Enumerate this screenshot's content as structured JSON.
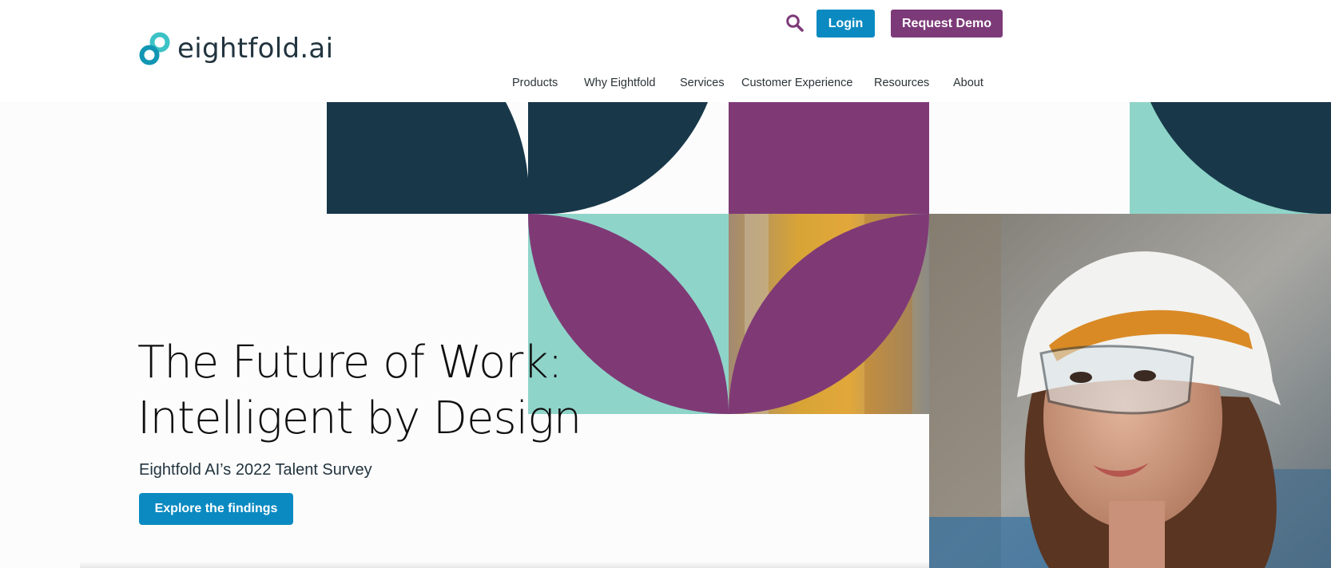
{
  "brand": {
    "name": "eightfold.ai",
    "logo_colors": [
      "#1aa3b7",
      "#3cc3c6",
      "#0f6f8f"
    ]
  },
  "header": {
    "search_icon": "search-icon",
    "login_label": "Login",
    "demo_label": "Request Demo"
  },
  "nav": {
    "items": [
      {
        "label": "Products"
      },
      {
        "label": "Why Eightfold"
      },
      {
        "label": "Services"
      },
      {
        "label": "Customer Experience"
      },
      {
        "label": "Resources"
      },
      {
        "label": "About"
      }
    ]
  },
  "hero": {
    "headline_line1": "The Future of Work:",
    "headline_line2": "Intelligent by Design",
    "subheadline": "Eightfold AI’s 2022 Talent Survey",
    "cta_label": "Explore the findings"
  },
  "colors": {
    "accent_blue": "#0b8ac1",
    "accent_purple": "#7c3a78",
    "navy": "#18384a",
    "mint": "#8fd4c9"
  }
}
